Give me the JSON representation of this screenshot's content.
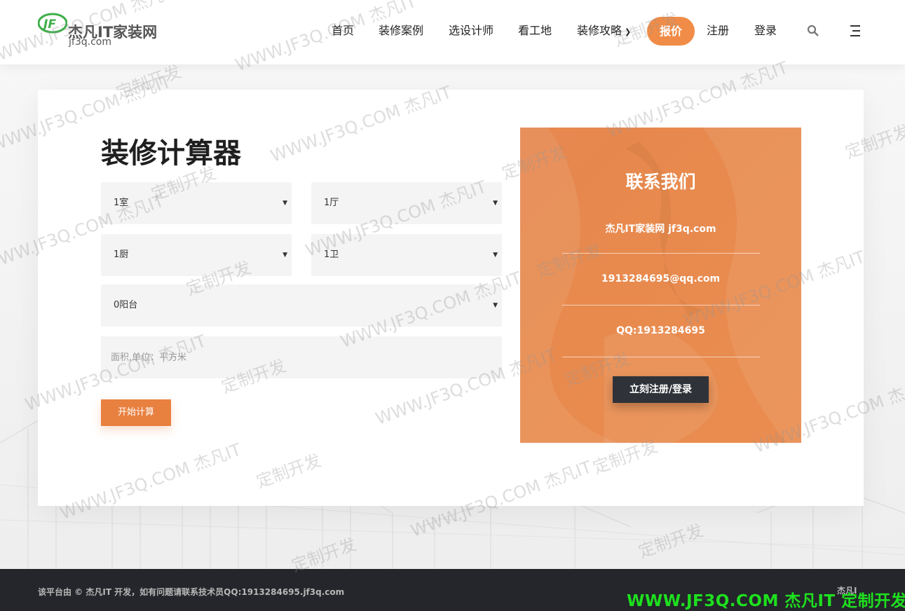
{
  "header": {
    "logo_title": "杰凡IT家装网",
    "logo_sub": "jf3q.com",
    "nav": [
      "首页",
      "装修案例",
      "选设计师",
      "看工地",
      "装修攻略"
    ],
    "quote_label": "报价",
    "register_label": "注册",
    "login_label": "登录"
  },
  "calculator": {
    "title": "装修计算器",
    "rooms": "1室",
    "halls": "1厅",
    "kitchens": "1厨",
    "baths": "1卫",
    "balconies": "0阳台",
    "area_placeholder": "面积,单位：平方米",
    "submit_label": "开始计算"
  },
  "contact": {
    "title": "联系我们",
    "site": "杰凡IT家装网 jf3q.com",
    "email": "1913284695@qq.com",
    "qq": "QQ:1913284695",
    "button_label": "立刻注册/登录"
  },
  "footer": {
    "text": "该平台由 © 杰凡IT 开发，如有问题请联系技术员QQ:1913284695.jf3q.com",
    "right": "杰凡I"
  },
  "watermark": {
    "brand": "WWW.JF3Q.COM 杰凡IT  定制开发",
    "a": "WWW.JF3Q.COM 杰凡IT",
    "b": "定制开发"
  },
  "colors": {
    "accent": "#f08c47",
    "contact_bg": "#e88a4e",
    "footer_bg": "#24262b",
    "brand_green": "#1ee01e"
  }
}
